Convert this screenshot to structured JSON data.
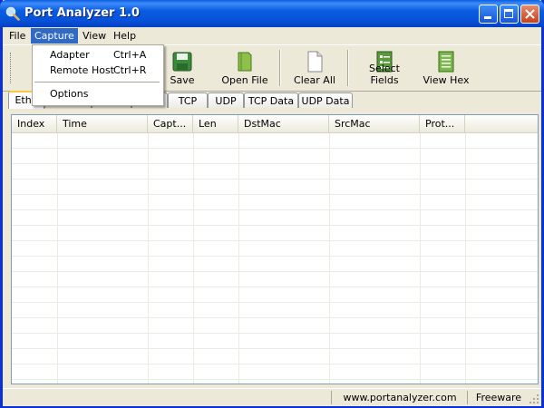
{
  "window": {
    "title": "Port Analyzer 1.0"
  },
  "menubar": {
    "items": [
      "File",
      "Capture",
      "View",
      "Help"
    ]
  },
  "capture_menu": {
    "items": [
      {
        "label": "Adapter",
        "shortcut": "Ctrl+A"
      },
      {
        "label": "Remote Host",
        "shortcut": "Ctrl+R"
      },
      {
        "label": "Options",
        "shortcut": ""
      }
    ]
  },
  "toolbar": {
    "save": "Save",
    "open_file": "Open File",
    "clear_all": "Clear All",
    "select_fields": "Select Fields",
    "view_hex": "View Hex"
  },
  "tabs": [
    "Ethe",
    "",
    "",
    "",
    "TCP",
    "UDP",
    "TCP Data",
    "UDP Data"
  ],
  "table": {
    "columns": [
      "Index",
      "Time",
      "Capt...",
      "Len",
      "DstMac",
      "SrcMac",
      "Prot..."
    ]
  },
  "statusbar": {
    "url": "www.portanalyzer.com",
    "license": "Freeware"
  },
  "colors": {
    "title_blue": "#0a5ce0",
    "menu_highlight": "#316ac5",
    "tab_accent": "#ffc83c"
  }
}
